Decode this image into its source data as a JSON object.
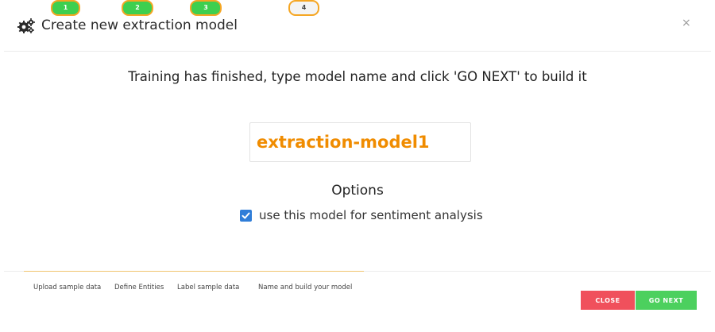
{
  "modal": {
    "title": "Create new extraction model",
    "header_icon": "gears-icon",
    "close_icon": "close-icon",
    "close_glyph": "×",
    "message": "Training has finished, type model name and click 'GO NEXT' to build it"
  },
  "model_name": {
    "value": "extraction-model1",
    "color": "#f08c00"
  },
  "options": {
    "title": "Options",
    "sentiment_checkbox": {
      "label": "use this model for sentiment analysis",
      "checked": true
    }
  },
  "steps": [
    {
      "number": "1",
      "label": "Upload sample data",
      "state": "done"
    },
    {
      "number": "2",
      "label": "Define Entities",
      "state": "done"
    },
    {
      "number": "3",
      "label": "Label sample data",
      "state": "done"
    },
    {
      "number": "4",
      "label": "Name and build your model",
      "state": "current"
    }
  ],
  "buttons": {
    "close_label": "CLOSE",
    "next_label": "GO NEXT"
  },
  "colors": {
    "accent_orange": "#f08c00",
    "step_done": "#3ecf4f",
    "step_border": "#f5a623",
    "checkbox": "#2f7dd8",
    "close_button": "#f0505c",
    "next_button": "#4cd05e"
  }
}
